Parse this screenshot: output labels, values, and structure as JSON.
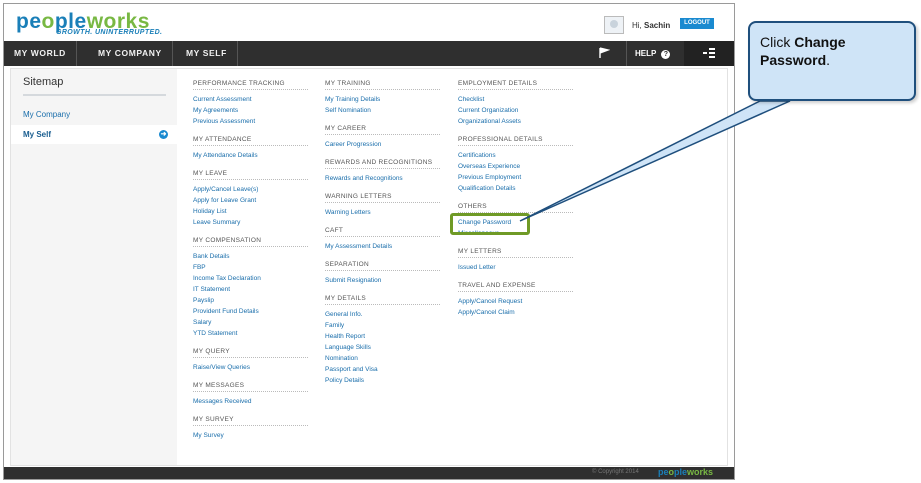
{
  "header": {
    "logo_part1": "pe",
    "logo_part2": "ple",
    "logo_part3": "works",
    "tagline": "GROWTH. UNINTERRUPTED.",
    "greeting": "Hi,",
    "user_name": "Sachin",
    "logout_label": "LOGOUT"
  },
  "nav": {
    "items": [
      "MY WORLD",
      "MY COMPANY",
      "MY SELF"
    ],
    "help_label": "HELP"
  },
  "sidebar": {
    "title": "Sitemap",
    "items": [
      "My Company",
      "My Self"
    ]
  },
  "columns": [
    {
      "sections": [
        {
          "heading": "PERFORMANCE TRACKING",
          "links": [
            "Current Assessment",
            "My Agreements",
            "Previous Assessment"
          ]
        },
        {
          "heading": "MY ATTENDANCE",
          "links": [
            "My Attendance Details"
          ]
        },
        {
          "heading": "MY LEAVE",
          "links": [
            "Apply/Cancel Leave(s)",
            "Apply for Leave Grant",
            "Holiday List",
            "Leave Summary"
          ]
        },
        {
          "heading": "MY COMPENSATION",
          "links": [
            "Bank Details",
            "FBP",
            "Income Tax Declaration",
            "IT Statement",
            "Payslip",
            "Provident Fund Details",
            "Salary",
            "YTD Statement"
          ]
        },
        {
          "heading": "MY QUERY",
          "links": [
            "Raise/View Queries"
          ]
        },
        {
          "heading": "MY MESSAGES",
          "links": [
            "Messages Received"
          ]
        },
        {
          "heading": "MY SURVEY",
          "links": [
            "My Survey"
          ]
        }
      ]
    },
    {
      "sections": [
        {
          "heading": "MY TRAINING",
          "links": [
            "My Training Details",
            "Self Nomination"
          ]
        },
        {
          "heading": "MY CAREER",
          "links": [
            "Career Progression"
          ]
        },
        {
          "heading": "REWARDS AND RECOGNITIONS",
          "links": [
            "Rewards and Recognitions"
          ]
        },
        {
          "heading": "WARNING LETTERS",
          "links": [
            "Warning Letters"
          ]
        },
        {
          "heading": "CAFT",
          "links": [
            "My Assessment Details"
          ]
        },
        {
          "heading": "SEPARATION",
          "links": [
            "Submit Resignation"
          ]
        },
        {
          "heading": "MY DETAILS",
          "links": [
            "General Info.",
            "Family",
            "Health Report",
            "Language Skills",
            "Nomination",
            "Passport and Visa",
            "Policy Details"
          ]
        }
      ]
    },
    {
      "sections": [
        {
          "heading": "EMPLOYMENT DETAILS",
          "links": [
            "Checklist",
            "Current Organization",
            "Organizational Assets"
          ]
        },
        {
          "heading": "PROFESSIONAL DETAILS",
          "links": [
            "Certifications",
            "Overseas Experience",
            "Previous Employment",
            "Qualification Details"
          ]
        },
        {
          "heading": "OTHERS",
          "links": [
            "Change Password",
            "Miscellaneous"
          ]
        },
        {
          "heading": "MY LETTERS",
          "links": [
            "Issued Letter"
          ]
        },
        {
          "heading": "TRAVEL AND EXPENSE",
          "links": [
            "Apply/Cancel Request",
            "Apply/Cancel Claim"
          ]
        }
      ]
    }
  ],
  "footer": {
    "copyright": "© Copyright 2014",
    "logo_part1": "pe",
    "logo_part2": "ple",
    "logo_part3": "works"
  },
  "callout": {
    "prefix": "Click ",
    "bold": "Change Password",
    "suffix": "."
  },
  "colors": {
    "brand_blue": "#1a7fb8",
    "brand_green": "#78b843",
    "nav_dark": "#2f2f2f",
    "highlight_green": "#6f9a26",
    "callout_fill": "#cfe4f7",
    "callout_border": "#1f4f7d"
  }
}
